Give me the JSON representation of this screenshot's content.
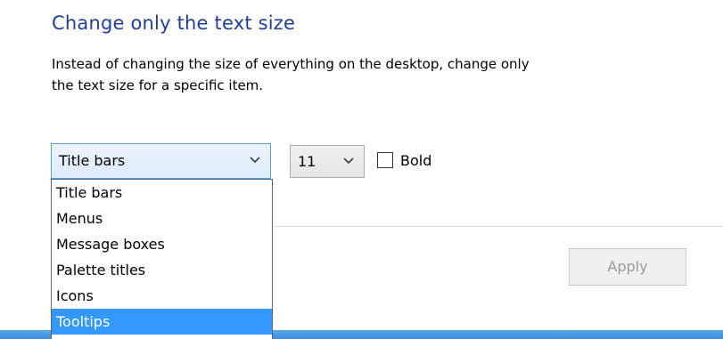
{
  "section": {
    "heading": "Change only the text size",
    "description_line1": "Instead of changing the size of everything on the desktop, change only",
    "description_line2": "the text size for a specific item."
  },
  "item_select": {
    "value": "Title bars",
    "icon": "chevron-down-icon"
  },
  "size_select": {
    "value": "11",
    "icon": "chevron-down-icon"
  },
  "bold_checkbox": {
    "label": "Bold",
    "checked": false
  },
  "apply_button": {
    "label": "Apply",
    "enabled": false
  },
  "dropdown": {
    "items": [
      {
        "label": "Title bars"
      },
      {
        "label": "Menus"
      },
      {
        "label": "Message boxes"
      },
      {
        "label": "Palette titles"
      },
      {
        "label": "Icons"
      },
      {
        "label": "Tooltips"
      }
    ],
    "highlighted": "Tooltips"
  },
  "colors": {
    "heading": "#1e3e9a",
    "highlight": "#3399ff",
    "select_border": "#569de5",
    "bottom_bar": "#4a9be2"
  }
}
